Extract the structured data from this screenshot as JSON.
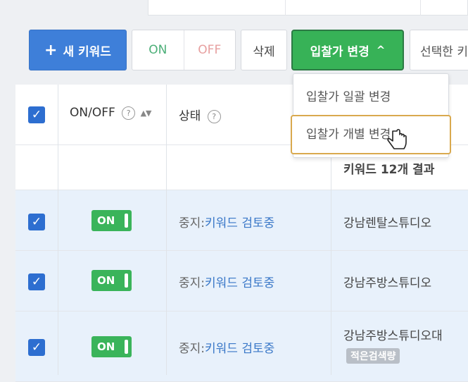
{
  "toolbar": {
    "new_keyword": "새 키워드",
    "on": "ON",
    "off": "OFF",
    "delete": "삭제",
    "bid_change": "입찰가 변경",
    "selected": "선택한 키"
  },
  "dropdown": {
    "items": [
      "입찰가 일괄 변경",
      "입찰가 개별 변경"
    ]
  },
  "table": {
    "headers": {
      "onoff": "ON/OFF",
      "status": "상태"
    },
    "result_count": "키워드 12개 결과",
    "rows": [
      {
        "toggle": "ON",
        "status_prefix": "중지:",
        "status_kw": "키워드 검토중",
        "keyword": "강남렌탈스튜디오"
      },
      {
        "toggle": "ON",
        "status_prefix": "중지:",
        "status_kw": "키워드 검토중",
        "keyword": "강남주방스튜디오"
      },
      {
        "toggle": "ON",
        "status_prefix": "중지:",
        "status_kw": "키워드 검토중",
        "keyword": "강남주방스튜디오대",
        "badge": "적은검색량"
      }
    ]
  },
  "colors": {
    "primary": "#3e7fd9",
    "bid_green": "#37b257",
    "toggle_green": "#3ab45a",
    "row_selected": "#e8f1fb",
    "status_link": "#3a78c8"
  }
}
